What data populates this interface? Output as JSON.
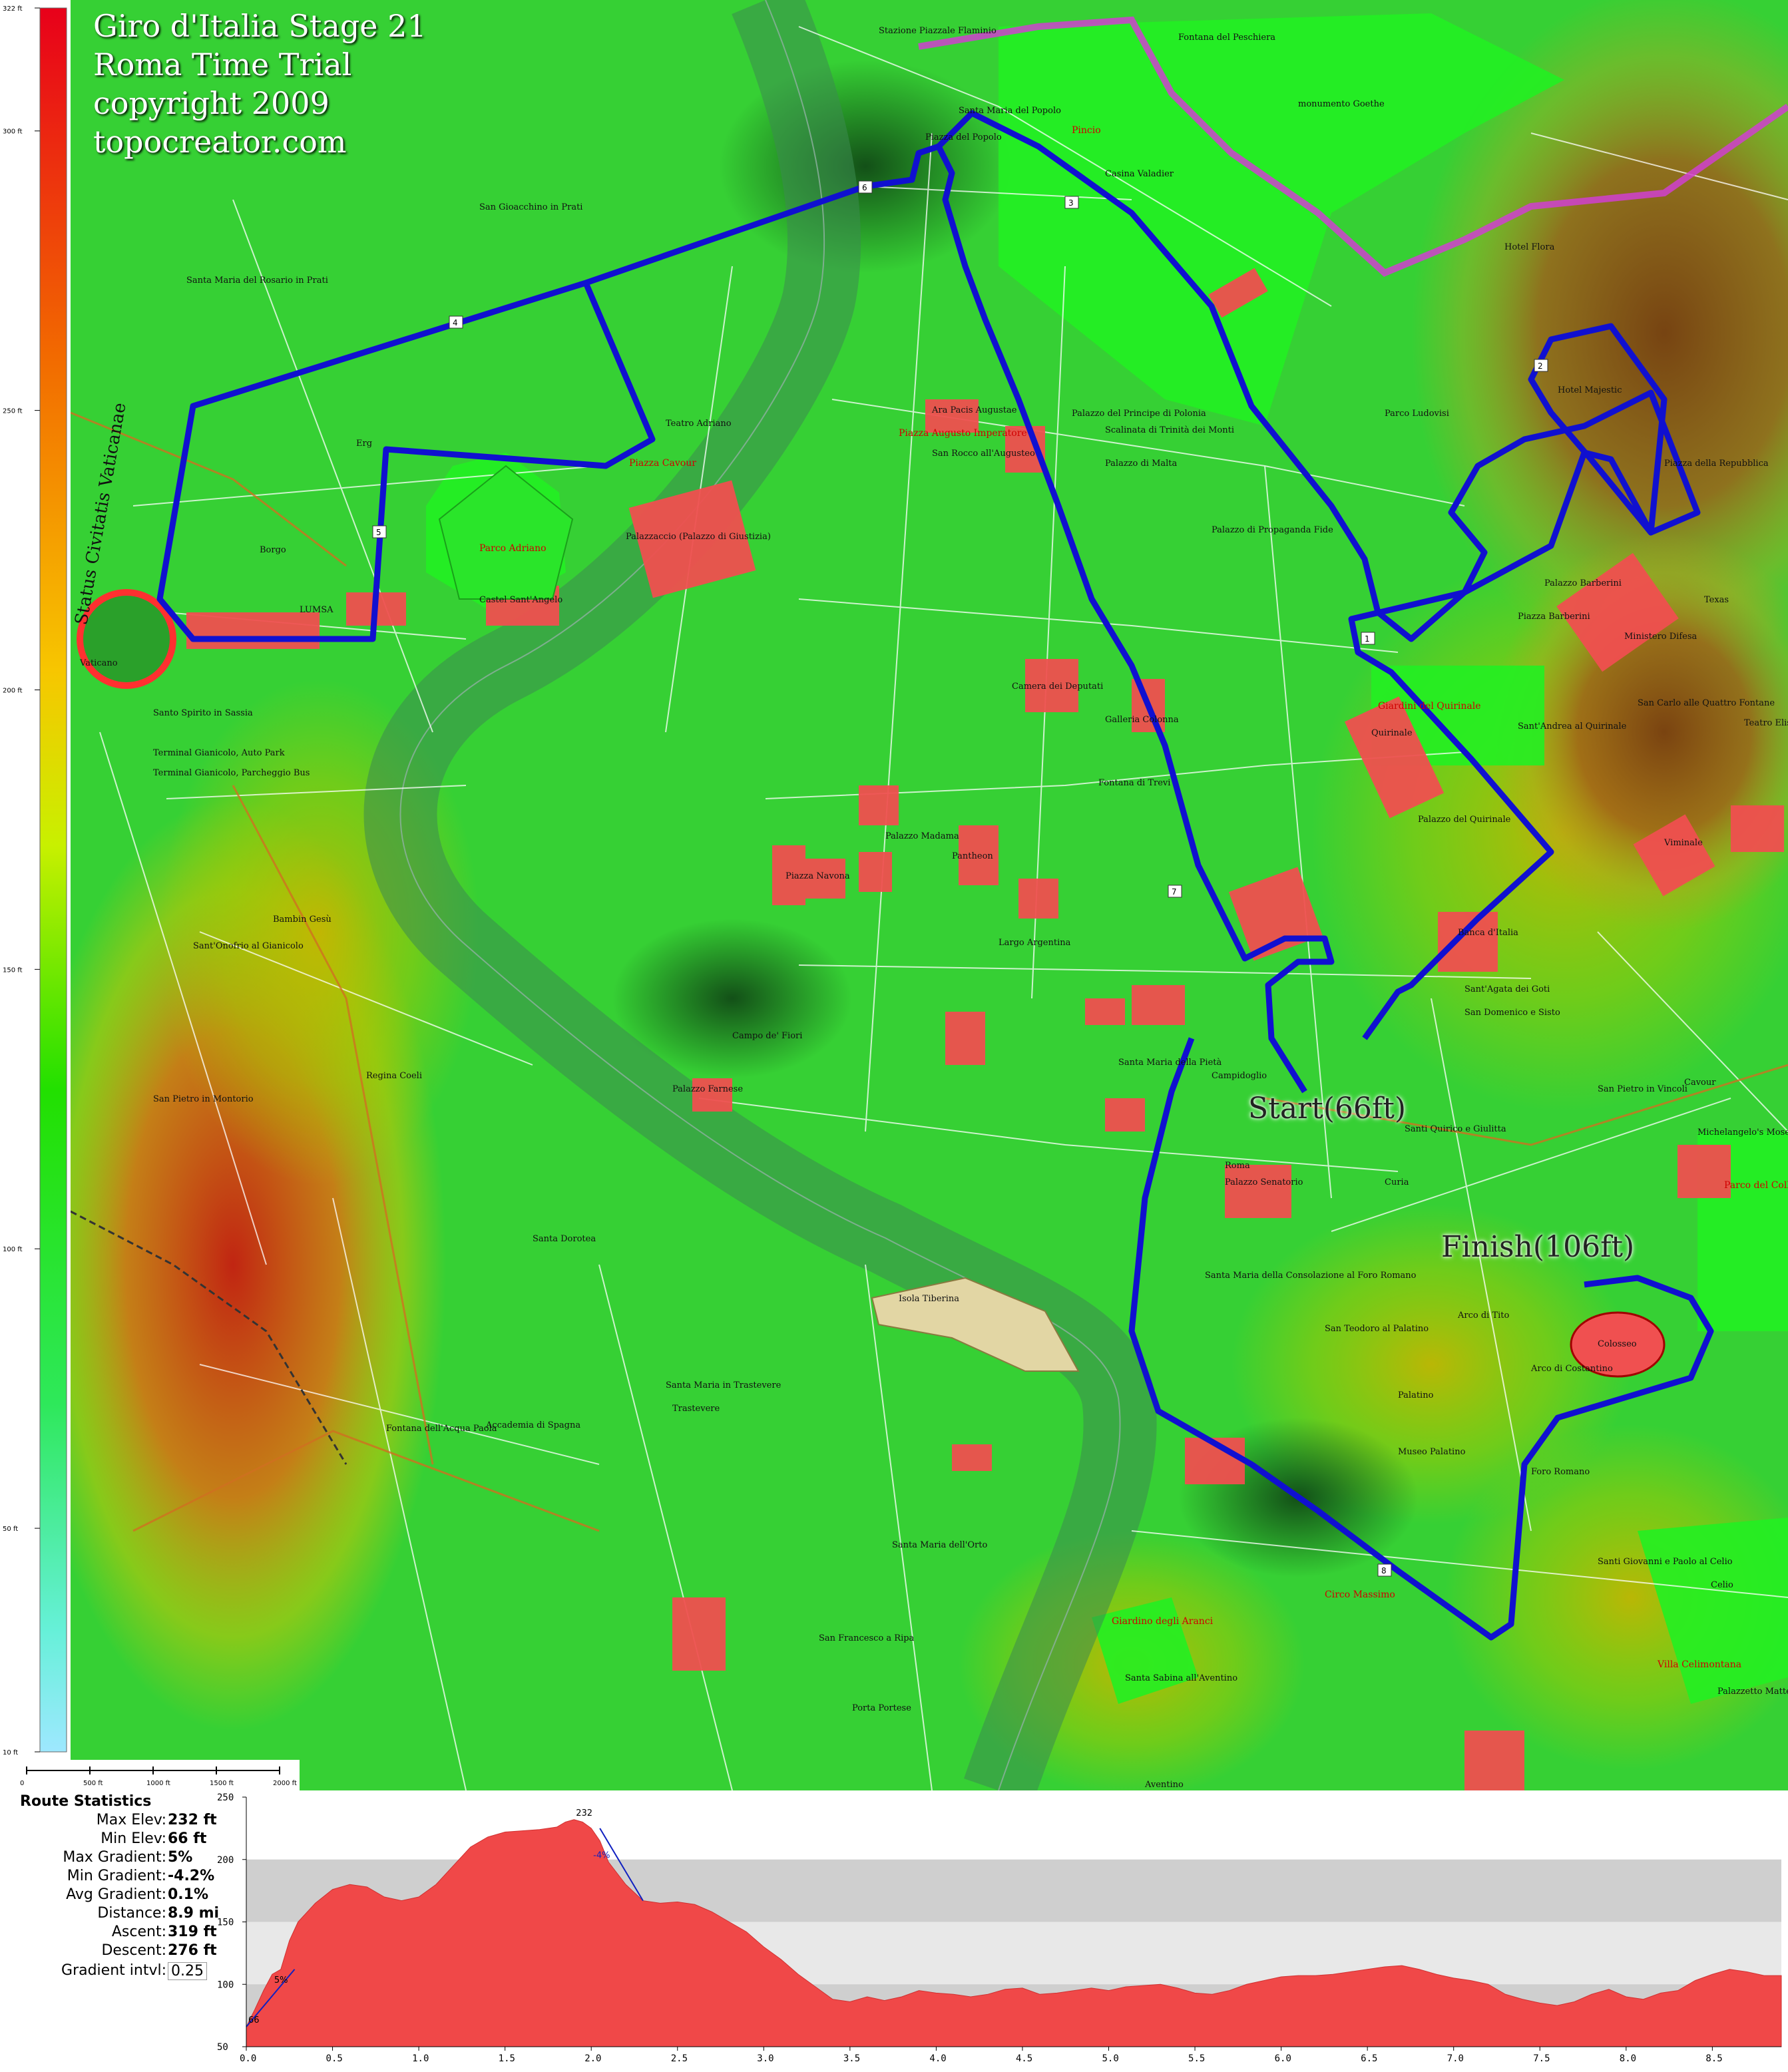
{
  "title_lines": [
    "Giro d'Italia Stage 21",
    "Roma Time Trial",
    "copyright 2009",
    "topocreator.com"
  ],
  "legend": {
    "ticks": [
      "322 ft",
      "300 ft",
      "250 ft",
      "200 ft",
      "150 ft",
      "100 ft",
      "50 ft",
      "10 ft"
    ],
    "gradient_colors": [
      "#e8001a",
      "#f26a00",
      "#f7c600",
      "#c8f000",
      "#22e000",
      "#2ee85a",
      "#66f0d8",
      "#9ee8ff"
    ]
  },
  "scale_bar": {
    "ticks": [
      "0",
      "500 ft",
      "1000 ft",
      "1500 ft",
      "2000 ft"
    ]
  },
  "route_labels": {
    "start": "Start(66ft)",
    "finish": "Finish(106ft)"
  },
  "route_markers": [
    "1",
    "2",
    "3",
    "4",
    "5",
    "6",
    "7",
    "8"
  ],
  "place_labels": [
    "Stazione Piazzale Flaminio",
    "Santa Maria del Popolo",
    "Pincio",
    "Piazza del Popolo",
    "monumento Goethe",
    "Casina Valadier",
    "Fontana del Peschiera",
    "Hotel Flora",
    "Hotel Majestic",
    "Parco Ludovisi",
    "Teatro Adriano",
    "Piazza Cavour",
    "Palazzaccio (Palazzo di Giustizia)",
    "Parco Adriano",
    "Castel Sant'Angelo",
    "Borgo",
    "Erg",
    "LUMSA",
    "Status Civitatis Vaticanae",
    "Vaticano",
    "Santa Maria del Rosario in Prati",
    "San Gioacchino in Prati",
    "Ara Pacis Augustae",
    "Piazza Augusto Imperatore",
    "San Rocco all'Augusteo",
    "Palazzo di Malta",
    "Palazzo di Propaganda Fide",
    "Camera dei Deputati",
    "Galleria Colonna",
    "Pantheon",
    "Piazza Navona",
    "Campo de' Fiori",
    "Palazzo Farnese",
    "Palazzo Madama",
    "Quirinale",
    "Giardini del Quirinale",
    "Palazzo del Quirinale",
    "Ministero Difesa",
    "Banca d'Italia",
    "Viminale",
    "Texas",
    "Piazza Barberini",
    "Palazzo Barberini",
    "Fontana di Trevi",
    "Largo Argentina",
    "Campidoglio",
    "Palazzo Senatorio",
    "Roma",
    "Curia",
    "Foro Romano",
    "Palatino",
    "Arco di Tito",
    "Arco di Costantino",
    "Colosseo",
    "Circo Massimo",
    "Isola Tiberina",
    "Trastevere",
    "Santa Maria in Trastevere",
    "Bambin Gesù",
    "Sant'Onofrio al Gianicolo",
    "Regina Coeli",
    "Fontana dell'Acqua Paola",
    "Accademia di Spagna",
    "Giardino degli Aranci",
    "Santa Sabina all'Aventino",
    "Aventino",
    "San Francesco a Ripa",
    "Porta Portese",
    "Santa Maria dell'Orto",
    "Parco del Colle Oppio",
    "Villa Celimontana",
    "Santi Giovanni e Paolo al Celio",
    "Terminal Gianicolo, Auto Park",
    "Terminal Gianicolo, Parcheggio Bus",
    "Santo Spirito in Sassia",
    "Santa Dorotea",
    "San Pietro in Montorio",
    "Museo Palatino",
    "San Teodoro al Palatino",
    "Santa Maria della Consolazione al Foro Romano",
    "Santa Maria della Pietà",
    "Michelangelo's Moses (statua)",
    "Celio",
    "Palazzetto Mattei",
    "Scalinata di Trinità dei Monti",
    "Palazzo del Principe di Polonia",
    "San Carlo alle Quattro Fontane",
    "Sant'Andrea al Quirinale",
    "Teatro Eliseo",
    "Sant'Agata dei Goti",
    "San Domenico e Sisto",
    "Santi Quirico e Giulitta",
    "Cavour",
    "San Pietro in Vincoli",
    "Piazza della Repubblica"
  ],
  "stats": {
    "heading": "Route Statistics",
    "rows": [
      {
        "label": "Max Elev:",
        "value": "232 ft"
      },
      {
        "label": "Min Elev:",
        "value": "66 ft"
      },
      {
        "label": "Max Gradient:",
        "value": "5%"
      },
      {
        "label": "Min Gradient:",
        "value": "-4.2%"
      },
      {
        "label": "Avg Gradient:",
        "value": "0.1%"
      },
      {
        "label": "Distance:",
        "value": "8.9 mi"
      },
      {
        "label": "Ascent:",
        "value": "319 ft"
      },
      {
        "label": "Descent:",
        "value": "276 ft"
      }
    ],
    "interval_label": "Gradient intvl:",
    "interval_value": "0.25"
  },
  "chart_data": {
    "type": "area",
    "xlabel": "",
    "ylabel": "",
    "xlim": [
      0,
      8.9
    ],
    "ylim": [
      50,
      250
    ],
    "xticks": [
      "0.0",
      "0.5",
      "1.0",
      "1.5",
      "2.0",
      "2.5",
      "3.0",
      "3.5",
      "4.0",
      "4.5",
      "5.0",
      "5.5",
      "6.0",
      "6.5",
      "7.0",
      "7.5",
      "8.0",
      "8.5"
    ],
    "yticks": [
      "50",
      "100",
      "150",
      "200",
      "250"
    ],
    "annotations": [
      {
        "text": "232",
        "x": 1.95,
        "y": 232
      },
      {
        "text": "66",
        "x": 0.05,
        "y": 66
      },
      {
        "text": "5%",
        "x": 0.2,
        "y": 98
      },
      {
        "text": "-4%",
        "x": 2.05,
        "y": 198
      }
    ],
    "series": [
      {
        "x": [
          0.0,
          0.05,
          0.1,
          0.15,
          0.2,
          0.25,
          0.3,
          0.4,
          0.5,
          0.6,
          0.7,
          0.8,
          0.9,
          1.0,
          1.1,
          1.2,
          1.3,
          1.4,
          1.5,
          1.6,
          1.7,
          1.8,
          1.85,
          1.9,
          1.95,
          2.0,
          2.05,
          2.1,
          2.2,
          2.3,
          2.4,
          2.5,
          2.6,
          2.7,
          2.8,
          2.9,
          3.0,
          3.1,
          3.2,
          3.3,
          3.4,
          3.5,
          3.6,
          3.7,
          3.8,
          3.9,
          4.0,
          4.1,
          4.2,
          4.3,
          4.4,
          4.5,
          4.6,
          4.7,
          4.8,
          4.9,
          5.0,
          5.1,
          5.2,
          5.3,
          5.4,
          5.5,
          5.6,
          5.7,
          5.8,
          5.9,
          6.0,
          6.1,
          6.2,
          6.3,
          6.4,
          6.5,
          6.6,
          6.7,
          6.8,
          6.9,
          7.0,
          7.1,
          7.2,
          7.3,
          7.4,
          7.5,
          7.6,
          7.7,
          7.8,
          7.9,
          8.0,
          8.1,
          8.2,
          8.3,
          8.4,
          8.5,
          8.6,
          8.7,
          8.8,
          8.9
        ],
        "y": [
          66,
          80,
          95,
          108,
          112,
          135,
          150,
          165,
          176,
          180,
          178,
          170,
          167,
          170,
          180,
          195,
          210,
          218,
          222,
          223,
          224,
          226,
          230,
          232,
          230,
          225,
          215,
          198,
          180,
          167,
          165,
          166,
          164,
          158,
          150,
          142,
          130,
          120,
          108,
          98,
          88,
          86,
          90,
          87,
          90,
          95,
          93,
          92,
          90,
          92,
          96,
          97,
          92,
          93,
          95,
          97,
          95,
          98,
          99,
          100,
          97,
          93,
          92,
          95,
          100,
          103,
          106,
          107,
          107,
          108,
          110,
          112,
          114,
          115,
          112,
          108,
          105,
          103,
          100,
          92,
          88,
          85,
          83,
          86,
          92,
          96,
          90,
          88,
          93,
          95,
          103,
          108,
          112,
          110,
          107,
          107
        ]
      }
    ]
  }
}
